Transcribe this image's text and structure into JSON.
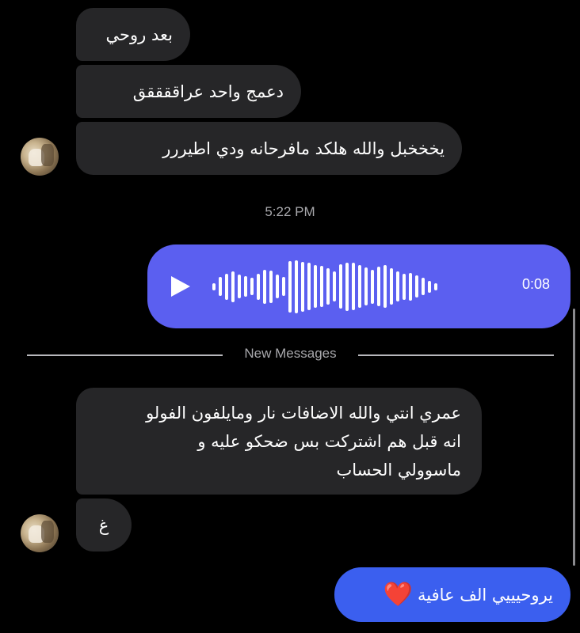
{
  "messages_incoming_group1": [
    "بعد روحي",
    "دعمج واحد عراققققق",
    "يخخخبل والله هلكد مافرحانه  ودي اطيررر"
  ],
  "timestamp": "5:22 PM",
  "voice_message": {
    "duration": "0:08",
    "waveform_levels": [
      0.08,
      0.22,
      0.3,
      0.36,
      0.28,
      0.24,
      0.2,
      0.3,
      0.4,
      0.38,
      0.28,
      0.22,
      0.6,
      0.62,
      0.58,
      0.55,
      0.5,
      0.48,
      0.42,
      0.35,
      0.52,
      0.56,
      0.55,
      0.5,
      0.44,
      0.4,
      0.46,
      0.5,
      0.42,
      0.35,
      0.3,
      0.32,
      0.26,
      0.2,
      0.14,
      0.08
    ],
    "bubble_color": "#5b5ff0"
  },
  "divider": {
    "label": "New Messages"
  },
  "messages_incoming_group2": {
    "long_message_lines": [
      "عمري انتي والله الاضافات نار ومايلفون الفولو",
      "انه قبل هم اشتركت بس ضحكو عليه و",
      "ماسوولي الحساب"
    ],
    "short_message": "غ"
  },
  "message_outgoing": {
    "text": "يروحيييي الف عافية",
    "emoji": "❤️",
    "bubble_color": "#3b5fef"
  },
  "colors": {
    "background": "#000000",
    "incoming_bubble": "#262628",
    "heart": "#e0182d"
  }
}
